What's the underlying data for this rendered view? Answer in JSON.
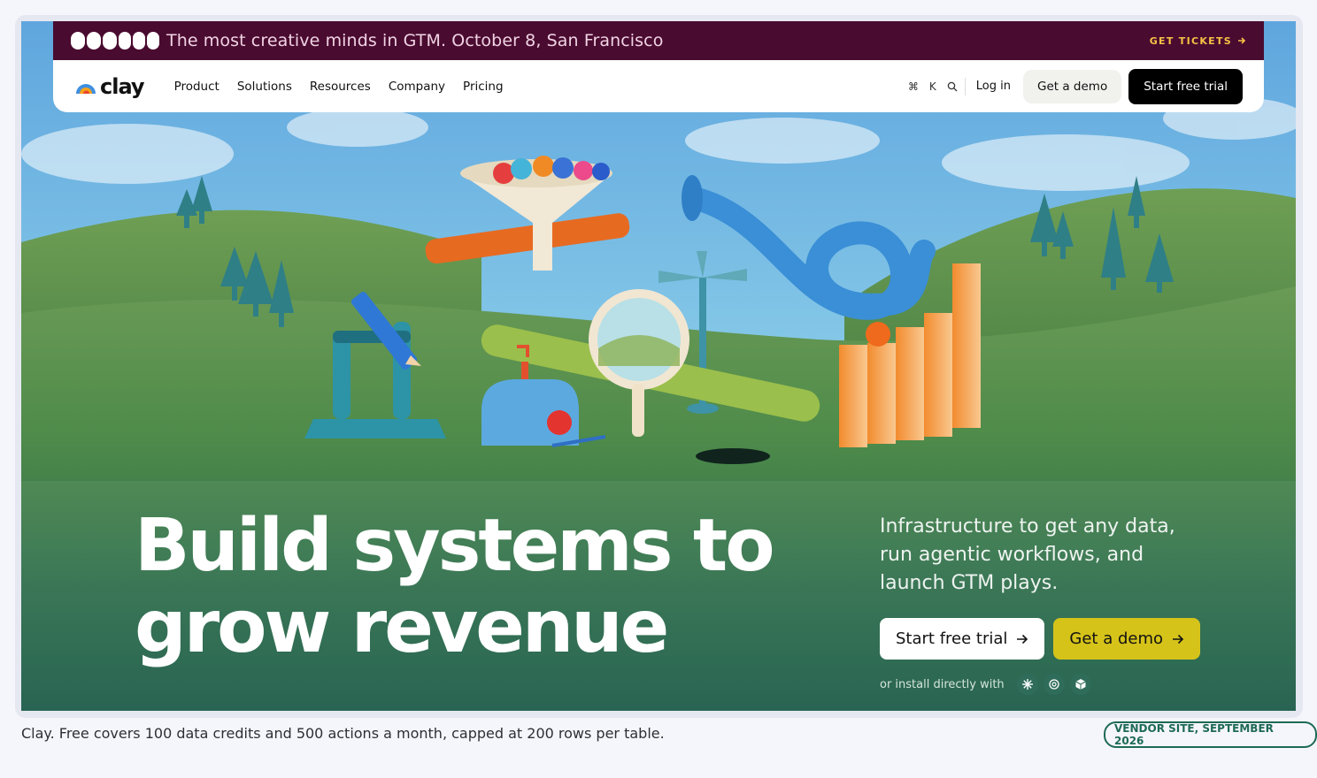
{
  "banner": {
    "event_logo": "SCULPT",
    "text": "The most creative minds in GTM. October 8, San Francisco",
    "cta_label": "GET TICKETS"
  },
  "nav": {
    "logo_text": "clay",
    "links": [
      "Product",
      "Solutions",
      "Resources",
      "Company",
      "Pricing"
    ],
    "shortcut_cmd": "⌘",
    "shortcut_key": "K",
    "login_label": "Log in",
    "demo_label": "Get a demo",
    "trial_label": "Start free trial"
  },
  "hero": {
    "headline_line1": "Build systems to",
    "headline_line2": "grow revenue",
    "subheading": "Infrastructure to get any data, run agentic workflows, and launch GTM plays.",
    "cta_primary": "Start free trial",
    "cta_secondary": "Get a demo",
    "install_label": "or install directly with",
    "install_icons": [
      "claude-icon",
      "openai-icon",
      "cube-icon"
    ]
  },
  "caption": "Clay. Free covers 100 data credits and 500 actions a month, capped at 200 rows per table.",
  "tag": "VENDOR SITE, SEPTEMBER 2026",
  "colors": {
    "banner_bg": "#4a0b30",
    "banner_cta": "#f6c245",
    "hero_bg": "#1b5b48",
    "cta_yellow": "#d6c31a",
    "tag_border": "#1e6a57"
  }
}
